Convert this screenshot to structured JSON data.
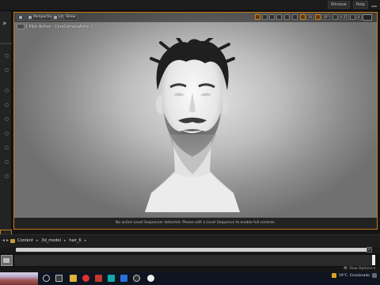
{
  "topbar": {
    "tabs": [
      "Window",
      "Help"
    ]
  },
  "viewport": {
    "perspective_label": "Perspective",
    "lit_label": "Lit",
    "show_label": "Show",
    "pilot_text": "[ Pilot Active - CineCameraActor ]",
    "status_message": "No active Level Sequencer detected. Please edit a Level Sequence to enable full controls.",
    "grid_value": "10",
    "angle_value": "10°",
    "scale_value": "0.25",
    "camera_speed": "4"
  },
  "content_browser": {
    "breadcrumb": [
      "Content",
      "3d_model",
      "hair_6"
    ],
    "view_options_label": "View Options"
  },
  "taskbar": {
    "weather": "19°C",
    "weather_desc": "Ensolarado"
  },
  "colors": {
    "accent": "#c47a17",
    "background": "#151515",
    "panel": "#232323"
  }
}
